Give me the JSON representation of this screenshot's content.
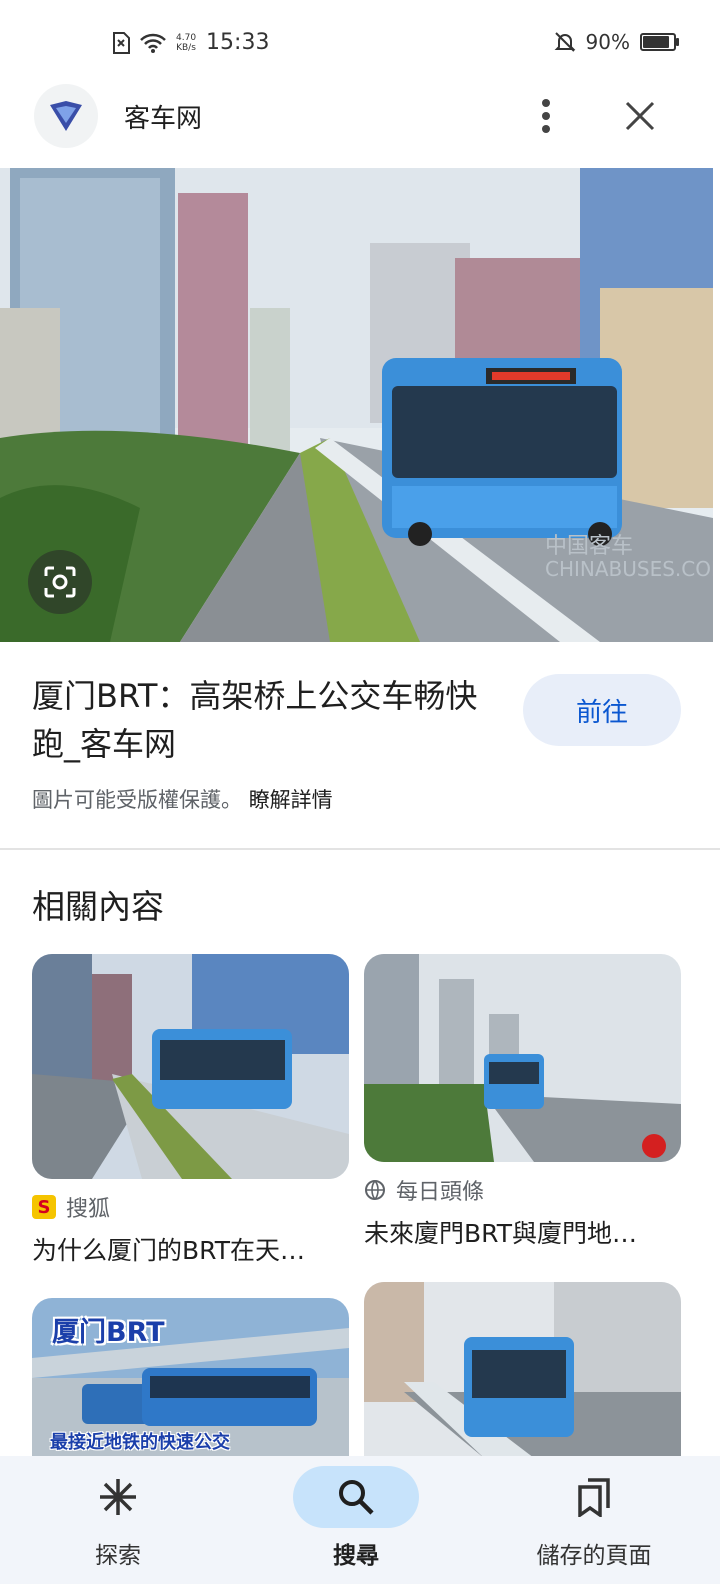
{
  "status_bar": {
    "time": "15:33",
    "net_speed_value": "4.70",
    "net_speed_unit": "KB/s",
    "battery": "90%"
  },
  "header": {
    "site_name": "客车网"
  },
  "result": {
    "title": "厦门BRT：高架桥上公交车畅快跑_客车网",
    "visit_label": "前往",
    "copyright_text": "圖片可能受版權保護。",
    "learn_more": "瞭解詳情"
  },
  "related": {
    "heading": "相關內容",
    "items": [
      {
        "source": "搜狐",
        "caption": "为什么厦门的BRT在天…",
        "source_icon": "sohu-logo"
      },
      {
        "source": "每日頭條",
        "caption": "未來廈門BRT與廈門地…",
        "source_icon": "globe-icon"
      },
      {
        "overlay_title": "厦门BRT",
        "overlay_text": "最接近地铁的快速公交"
      },
      {}
    ]
  },
  "bottom_nav": {
    "items": [
      {
        "label": "探索",
        "icon": "asterisk-icon"
      },
      {
        "label": "搜尋",
        "icon": "search-icon",
        "active": true
      },
      {
        "label": "儲存的頁面",
        "icon": "bookmarks-icon"
      }
    ]
  },
  "colors": {
    "accent": "#0b57d0",
    "active_pill": "#c7e3fb",
    "nav_bg": "#f2f5fa",
    "bus_blue": "#3b8fd9"
  }
}
